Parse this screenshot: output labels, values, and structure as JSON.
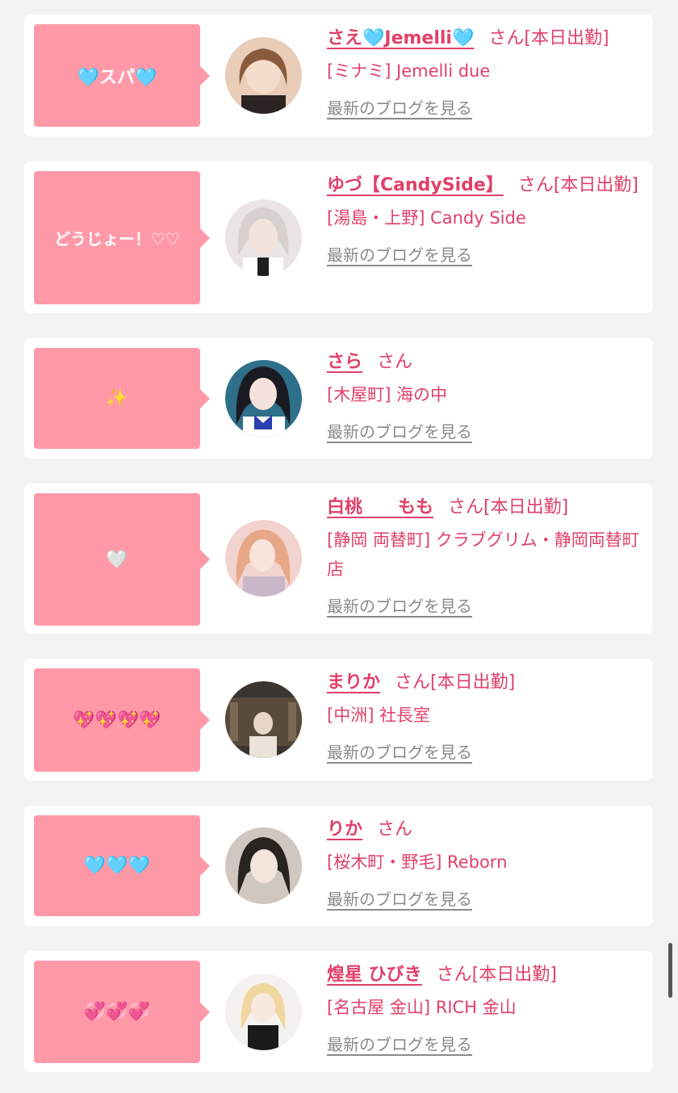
{
  "cast_list": [
    {
      "bubble": "🩵スパ🩵",
      "name": "さえ🩵Jemelli🩵",
      "suffix": "さん[本日出勤]",
      "shop": "[ミナミ] Jemelli due",
      "blog_link": "最新のブログを見る",
      "avatar_icon": "profile-photo"
    },
    {
      "bubble": "どうじょー！♡♡",
      "name": "ゆづ【CandySide】",
      "suffix": "さん[本日出勤]",
      "shop": "[湯島・上野] Candy Side",
      "blog_link": "最新のブログを見る",
      "avatar_icon": "profile-photo"
    },
    {
      "bubble": "✨",
      "name": "さら",
      "suffix": "さん",
      "shop": "[木屋町] 海の中",
      "blog_link": "最新のブログを見る",
      "avatar_icon": "profile-photo"
    },
    {
      "bubble": "🤍",
      "name": "白桃　　もも",
      "suffix": "さん[本日出勤]",
      "shop": "[静岡 両替町] クラブグリム・静岡両替町店",
      "blog_link": "最新のブログを見る",
      "avatar_icon": "profile-photo"
    },
    {
      "bubble": "💖💖💖💖",
      "name": "まりか",
      "suffix": "さん[本日出勤]",
      "shop": "[中洲] 社長室",
      "blog_link": "最新のブログを見る",
      "avatar_icon": "profile-photo"
    },
    {
      "bubble": "🩵🩵🩵",
      "name": "りか",
      "suffix": "さん",
      "shop": "[桜木町・野毛] Reborn",
      "blog_link": "最新のブログを見る",
      "avatar_icon": "profile-photo"
    },
    {
      "bubble": "💞💞💞",
      "name": "煌星 ひびき",
      "suffix": "さん[本日出勤]",
      "shop": "[名古屋 金山] RICH 金山",
      "blog_link": "最新のブログを見る",
      "avatar_icon": "profile-photo"
    }
  ],
  "colors": {
    "bubble_bg": "#ff99a8",
    "name_text": "#e0406a",
    "blog_link": "#8a8a8a",
    "page_bg": "#f3f3f3"
  }
}
